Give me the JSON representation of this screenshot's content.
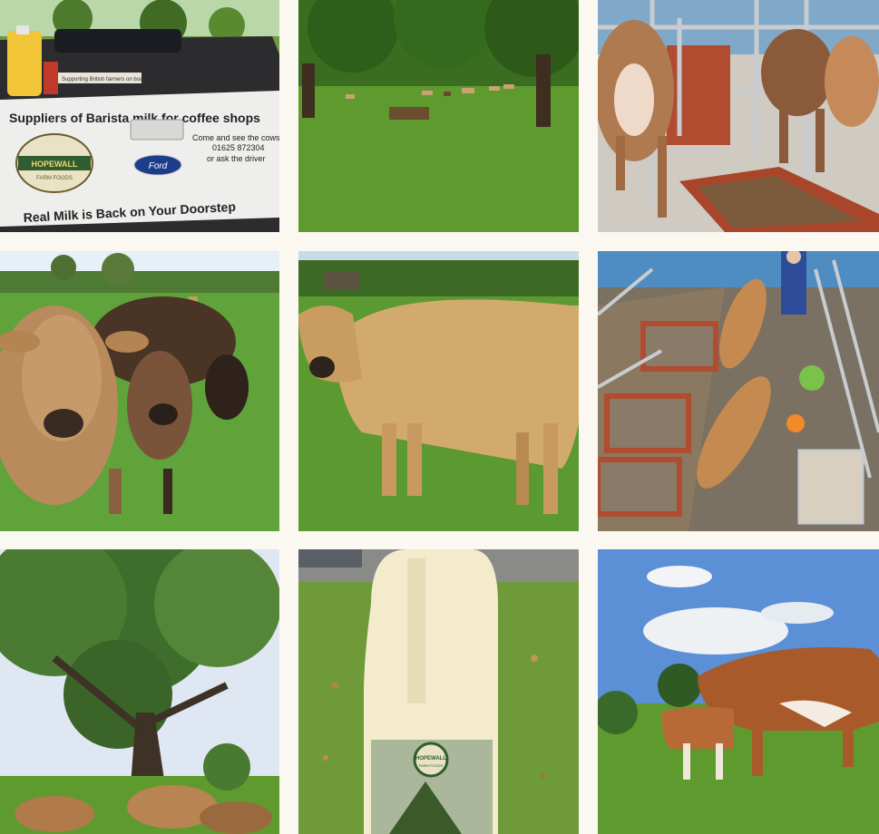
{
  "gallery": {
    "tiles": [
      {
        "name": "pickup-truck-photo"
      },
      {
        "name": "cows-grazing-field-photo"
      },
      {
        "name": "milking-parlour-photo"
      },
      {
        "name": "jersey-cows-closeup-photo"
      },
      {
        "name": "jersey-cow-standing-photo"
      },
      {
        "name": "parlour-overhead-photo"
      },
      {
        "name": "oak-tree-cows-photo"
      },
      {
        "name": "milk-bottle-photo"
      },
      {
        "name": "cow-and-calf-photo"
      }
    ]
  },
  "truck": {
    "line1": "Suppliers of Barista milk for coffee shops",
    "side1": "Come and see the cows",
    "side2": "01625 872304",
    "side3": "or ask the driver",
    "line2": "Real Milk is Back on Your Doorstep",
    "logo_top": "HOPEWALL",
    "logo_bottom": "FARM FOODS",
    "brand": "Ford",
    "sign": "Supporting British farmers on board"
  },
  "bottle": {
    "logo_top": "HOPEWALL",
    "logo_bottom": "FARM FOODS"
  },
  "colors": {
    "background": "#fbf8f2",
    "grass": "#5f9a2e",
    "sky": "#5b8fd6",
    "jersey": "#c49a62"
  }
}
